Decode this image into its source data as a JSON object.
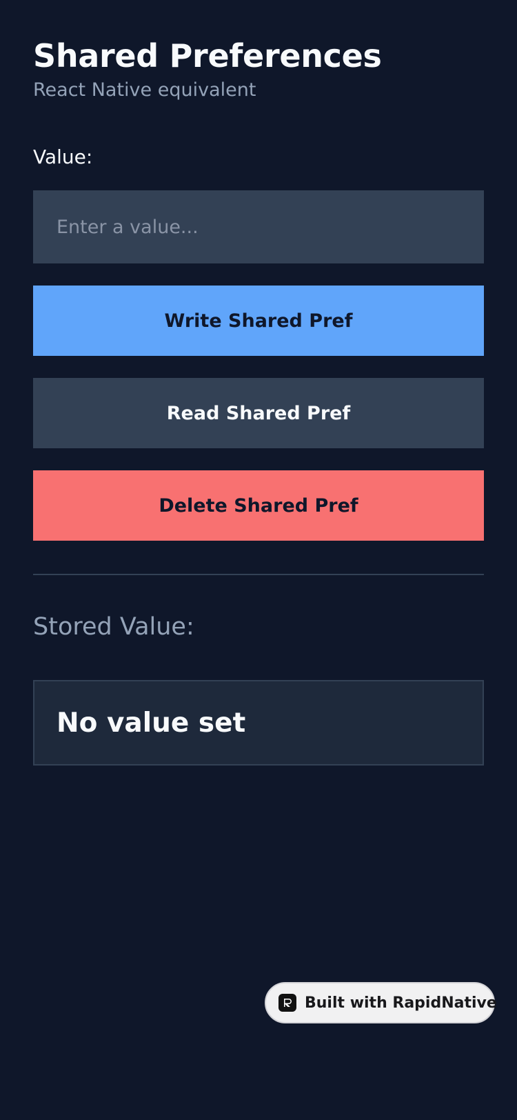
{
  "header": {
    "title": "Shared Preferences",
    "subtitle": "React Native equivalent"
  },
  "form": {
    "value_label": "Value:",
    "input_value": "",
    "input_placeholder": "Enter a value..."
  },
  "actions": {
    "write_label": "Write Shared Pref",
    "read_label": "Read Shared Pref",
    "delete_label": "Delete Shared Pref"
  },
  "stored": {
    "label": "Stored Value:",
    "value": "No value set"
  },
  "badge": {
    "label": "Built with RapidNative",
    "icon": "rapidnative-logo-icon"
  },
  "colors": {
    "background": "#0f172a",
    "input_background": "#334155",
    "write_button": "#60a5fa",
    "read_button": "#334155",
    "delete_button": "#f87171",
    "muted_text": "#94a3b8",
    "stored_box": "#1e293b"
  }
}
